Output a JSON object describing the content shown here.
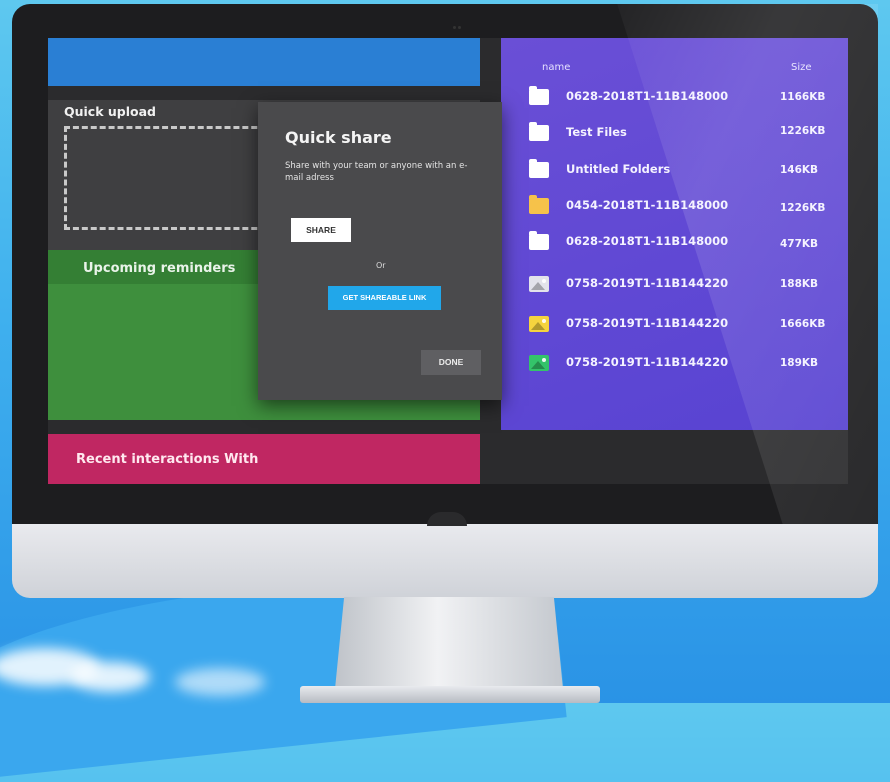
{
  "quick_upload": {
    "title": "Quick upload"
  },
  "reminders": {
    "title": "Upcoming reminders"
  },
  "recent": {
    "title": "Recent interactions With"
  },
  "file_list": {
    "headers": {
      "name": "name",
      "size": "Size"
    },
    "files": [
      {
        "name": "0628-2018T1-11B148000",
        "size": "1166KB",
        "icon": "folder-icon"
      },
      {
        "name": "Test Files",
        "size": "1226KB",
        "icon": "folder-icon"
      },
      {
        "name": "Untitled Folders",
        "size": "146KB",
        "icon": "folder-icon"
      },
      {
        "name": "0454-2018T1-11B148000",
        "size": "1226KB",
        "icon": "folder-yellow-icon"
      },
      {
        "name": "0628-2018T1-11B148000",
        "size": "477KB",
        "icon": "folder-icon"
      },
      {
        "name": "0758-2019T1-11B144220",
        "size": "188KB",
        "icon": "image-gray-icon"
      },
      {
        "name": "0758-2019T1-11B144220",
        "size": "1666KB",
        "icon": "image-yellow-icon"
      },
      {
        "name": "0758-2019T1-11B144220",
        "size": "189KB",
        "icon": "image-green-icon"
      }
    ]
  },
  "modal": {
    "title": "Quick share",
    "description": "Share with your team or anyone with an e-mail adress",
    "share_label": "SHARE",
    "or_label": "Or",
    "link_label": "GET SHAREABLE LINK",
    "done_label": "DONE"
  },
  "colors": {
    "blue_bar": "#2a7fd4",
    "green_panel": "#3e8f3d",
    "pink_panel": "#c02762",
    "purple_panel": "#5d47d4",
    "link_button": "#21a7ea"
  }
}
